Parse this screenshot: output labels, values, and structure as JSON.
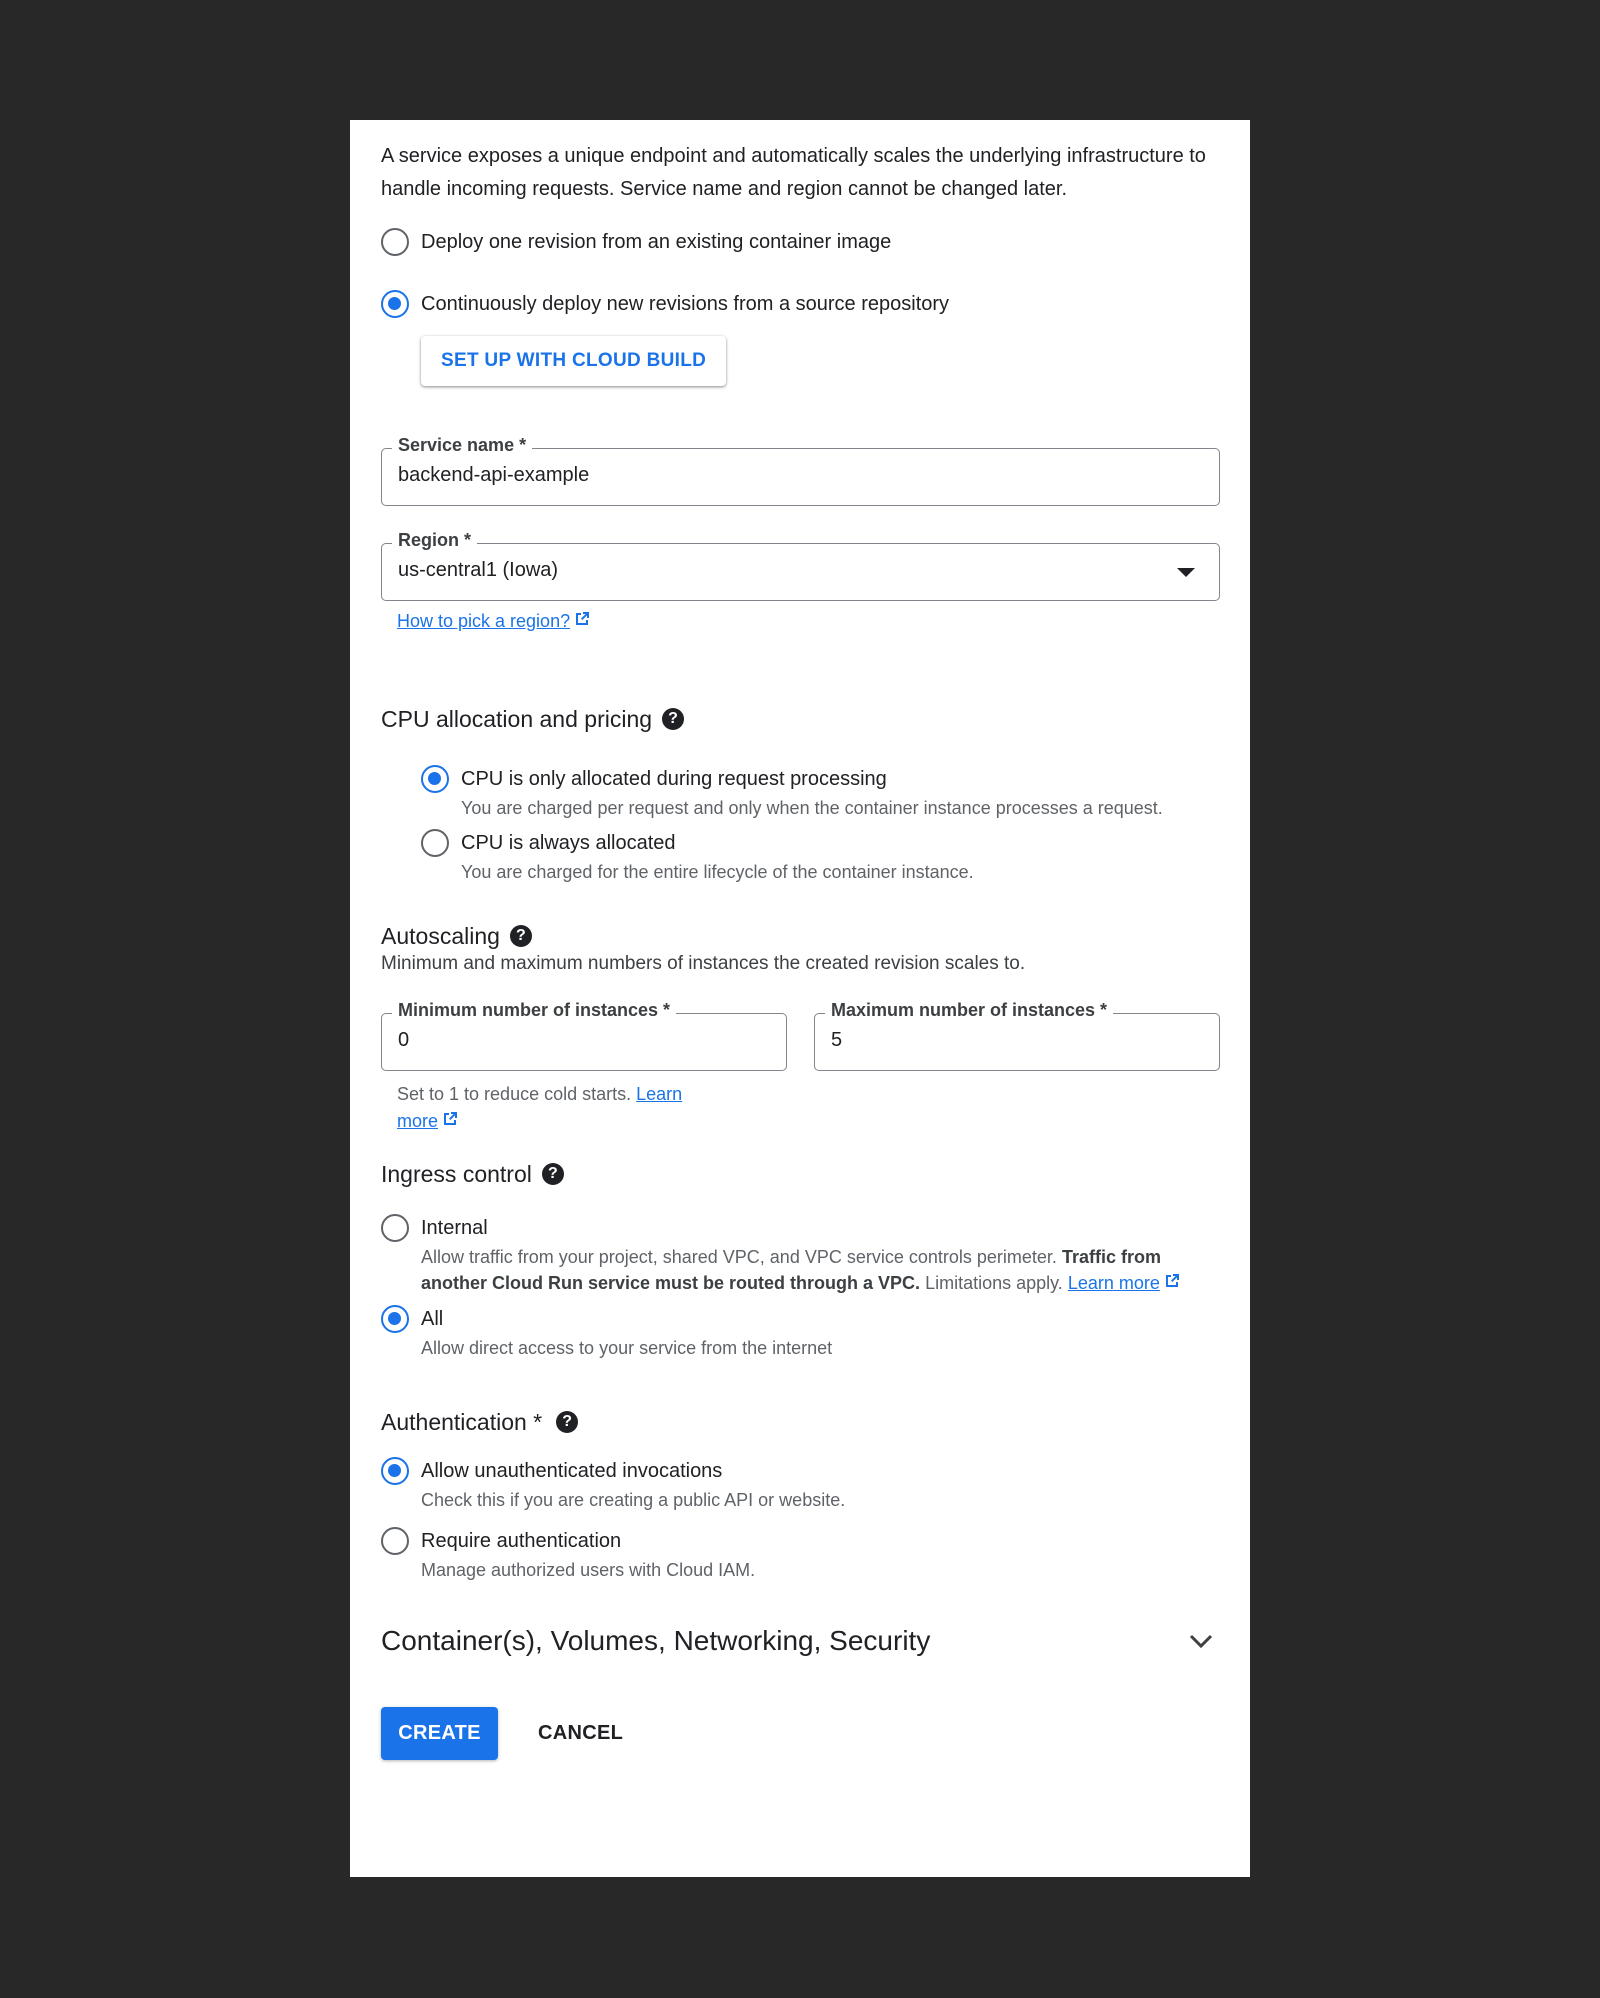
{
  "intro": "A service exposes a unique endpoint and automatically scales the underlying infrastructure to handle incoming requests. Service name and region cannot be changed later.",
  "deploy_options": [
    {
      "label": "Deploy one revision from an existing container image",
      "checked": false
    },
    {
      "label": "Continuously deploy new revisions from a source repository",
      "checked": true
    }
  ],
  "cloud_build_button": "SET UP WITH CLOUD BUILD",
  "service_name": {
    "label": "Service name *",
    "value": "backend-api-example"
  },
  "region": {
    "label": "Region *",
    "value": "us-central1 (Iowa)",
    "help_link": "How to pick a region?"
  },
  "cpu": {
    "title": "CPU allocation and pricing",
    "options": [
      {
        "label": "CPU is only allocated during request processing",
        "desc": "You are charged per request and only when the container instance processes a request.",
        "checked": true
      },
      {
        "label": "CPU is always allocated",
        "desc": "You are charged for the entire lifecycle of the container instance.",
        "checked": false
      }
    ]
  },
  "autoscaling": {
    "title": "Autoscaling",
    "desc": "Minimum and maximum numbers of instances the created revision scales to.",
    "min": {
      "label": "Minimum number of instances *",
      "value": "0"
    },
    "max": {
      "label": "Maximum number of instances *",
      "value": "5"
    },
    "hint": "Set to 1 to reduce cold starts.",
    "hint_link": "Learn more"
  },
  "ingress": {
    "title": "Ingress control",
    "internal": {
      "label": "Internal",
      "desc_start": "Allow traffic from your project, shared VPC, and VPC service controls perimeter.",
      "desc_bold": "Traffic from another Cloud Run service must be routed through a VPC.",
      "desc_end": "Limitations apply.",
      "link": "Learn more",
      "checked": false
    },
    "all": {
      "label": "All",
      "desc": "Allow direct access to your service from the internet",
      "checked": true
    }
  },
  "auth": {
    "title": "Authentication *",
    "options": [
      {
        "label": "Allow unauthenticated invocations",
        "desc": "Check this if you are creating a public API or website.",
        "checked": true
      },
      {
        "label": "Require authentication",
        "desc": "Manage authorized users with Cloud IAM.",
        "checked": false
      }
    ]
  },
  "advanced_section": "Container(s), Volumes, Networking, Security",
  "actions": {
    "create": "CREATE",
    "cancel": "CANCEL"
  },
  "colors": {
    "accent": "#1a73e8",
    "background": "#282828",
    "panel": "#ffffff"
  },
  "icons": [
    "radio-button",
    "help-icon",
    "external-link-icon",
    "dropdown-caret-icon",
    "chevron-down-icon"
  ]
}
